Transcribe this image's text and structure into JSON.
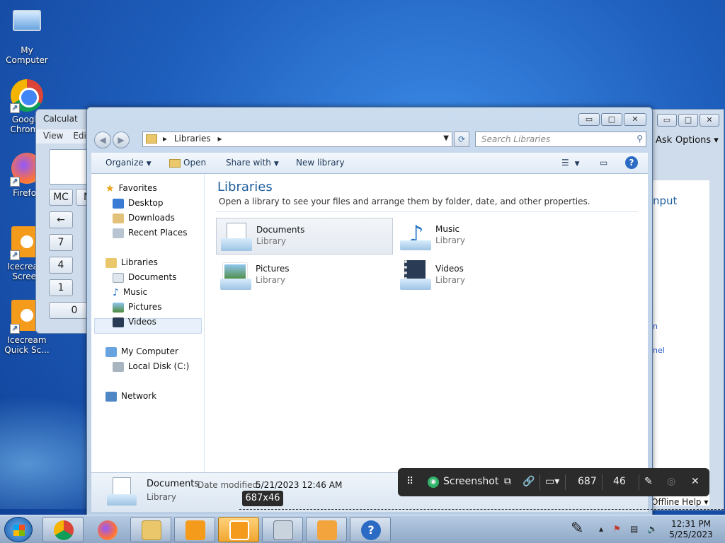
{
  "desktop": {
    "icons": [
      {
        "label": "My Computer"
      },
      {
        "label": "Google Chrome"
      },
      {
        "label": "Firefox"
      },
      {
        "label": "Icecream Screen"
      },
      {
        "label": "Icecream Quick Sc..."
      }
    ]
  },
  "calculator": {
    "title": "Calculat",
    "menu": [
      "View",
      "Edit"
    ],
    "buttons": [
      "MC",
      "M",
      "←",
      "7",
      "4",
      "1",
      "0"
    ]
  },
  "back_window": {
    "menu": [
      "Ask",
      "Options ▾"
    ],
    "text": [
      "nput",
      "n",
      "nel"
    ],
    "help": "Offline Help ▾"
  },
  "explorer": {
    "window_controls": [
      "▭",
      "□",
      "✕"
    ],
    "address": {
      "crumb": "Libraries",
      "arrow1": "▸",
      "arrow2": "▸"
    },
    "search_placeholder": "Search Libraries",
    "toolbar": {
      "organize": "Organize",
      "open": "Open",
      "share_with": "Share with",
      "new_library": "New library"
    },
    "nav": {
      "favorites": "Favorites",
      "desktop": "Desktop",
      "downloads": "Downloads",
      "recent_places": "Recent Places",
      "libraries": "Libraries",
      "documents": "Documents",
      "music": "Music",
      "pictures": "Pictures",
      "videos": "Videos",
      "my_computer": "My Computer",
      "local_disk": "Local Disk (C:)",
      "network": "Network"
    },
    "content": {
      "title": "Libraries",
      "description": "Open a library to see your files and arrange them by folder, date, and other properties.",
      "items": [
        {
          "name": "Documents",
          "type": "Library"
        },
        {
          "name": "Music",
          "type": "Library"
        },
        {
          "name": "Pictures",
          "type": "Library"
        },
        {
          "name": "Videos",
          "type": "Library"
        }
      ]
    },
    "details": {
      "name": "Documents",
      "date_label": "Date modified:",
      "date_value": "5/21/2023 12:46 AM",
      "type": "Library"
    }
  },
  "screenshot_bar": {
    "label": "Screenshot",
    "width": "687",
    "height": "46",
    "tooltip": "687x46"
  },
  "taskbar": {
    "time": "12:31 PM",
    "date": "5/25/2023"
  }
}
